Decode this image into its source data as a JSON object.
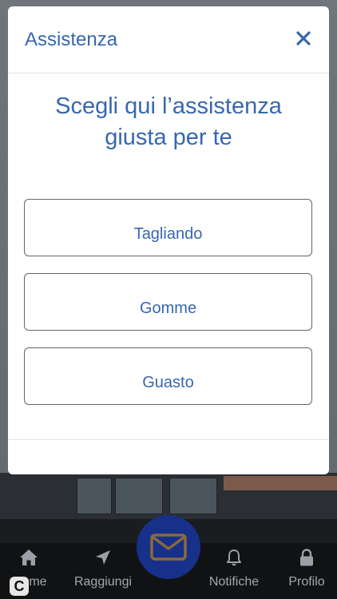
{
  "modal": {
    "title": "Assistenza",
    "heading": "Scegli qui l’assistenza giusta per te",
    "options": [
      {
        "label": "Tagliando"
      },
      {
        "label": "Gomme"
      },
      {
        "label": "Guasto"
      }
    ]
  },
  "tabbar": {
    "items": [
      {
        "label": "ome",
        "icon": "home-icon"
      },
      {
        "label": "Raggiungi",
        "icon": "navigation-arrow-icon"
      },
      {
        "label": "Notifiche",
        "icon": "bell-icon"
      },
      {
        "label": "Profilo",
        "icon": "lock-icon"
      }
    ],
    "fab_icon": "mail-icon"
  },
  "colors": {
    "accent": "#3767b0",
    "fab": "#17308a",
    "fab_icon": "#8a6a3a",
    "tabbar_bg": "#111214"
  }
}
